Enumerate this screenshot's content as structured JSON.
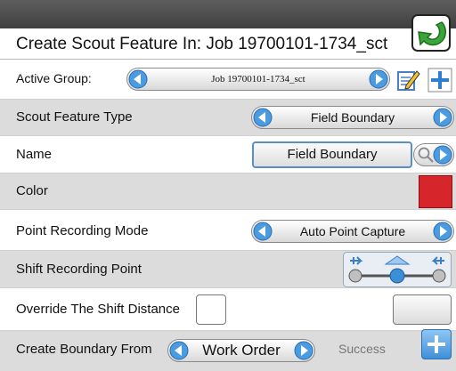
{
  "title": "Create Scout Feature In: Job 19700101-1734_sct",
  "rows": {
    "active_group": {
      "label": "Active Group:",
      "value": "Job 19700101-1734_sct"
    },
    "feature_type": {
      "label": "Scout Feature Type",
      "value": "Field Boundary"
    },
    "name": {
      "label": "Name",
      "value": "Field Boundary"
    },
    "color": {
      "label": "Color",
      "swatch": "#d6262b"
    },
    "recording_mode": {
      "label": "Point Recording Mode",
      "value": "Auto Point Capture"
    },
    "shift_point": {
      "label": "Shift Recording Point"
    },
    "override": {
      "label": "Override The Shift Distance"
    },
    "create_boundary": {
      "label": "Create Boundary From",
      "value": "Work Order",
      "status": "Success"
    }
  },
  "icons": {
    "back": "back-arrow-icon",
    "edit": "edit-note-icon",
    "add": "plus-icon",
    "search": "magnifier-icon",
    "shift": "shift-slider-icon"
  },
  "colors": {
    "accent": "#3a8fd6",
    "back_green": "#3aa63a"
  }
}
